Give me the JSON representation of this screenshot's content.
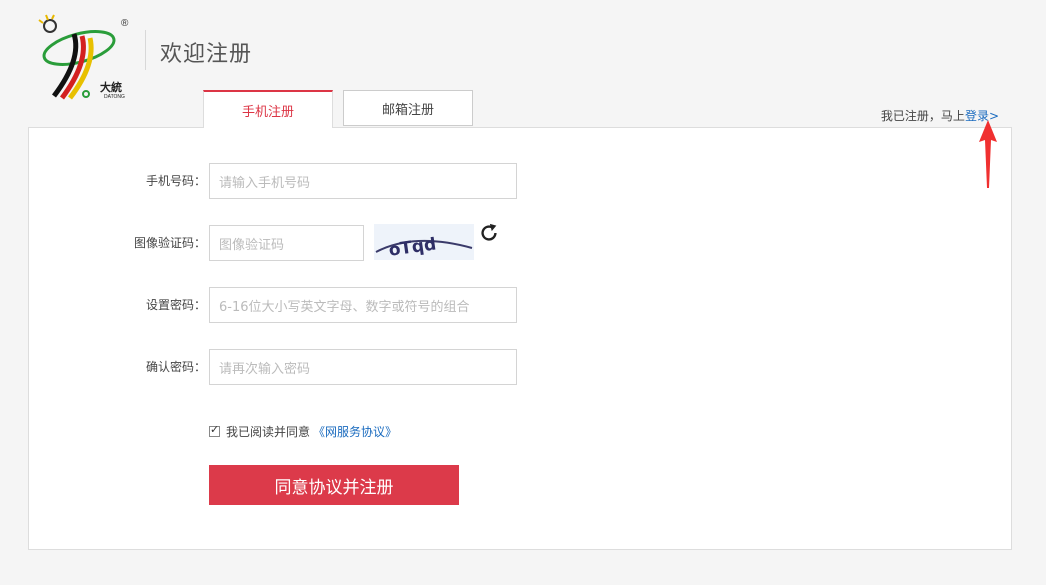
{
  "brand": {
    "name": "大統",
    "name_latin": "DATONG",
    "reg_mark": "®"
  },
  "page_title": "欢迎注册",
  "tabs": [
    {
      "label": "手机注册",
      "active": true
    },
    {
      "label": "邮箱注册",
      "active": false
    }
  ],
  "login_hint": {
    "text": "我已注册，马上",
    "link": "登录>"
  },
  "form": {
    "phone": {
      "label": "手机号码：",
      "placeholder": "请输入手机号码"
    },
    "captcha": {
      "label": "图像验证码：",
      "placeholder": "图像验证码",
      "image_text": "oTqd"
    },
    "password": {
      "label": "设置密码：",
      "placeholder": "6-16位大小写英文字母、数字或符号的组合"
    },
    "confirm": {
      "label": "确认密码：",
      "placeholder": "请再次输入密码"
    },
    "agree": {
      "checked": true,
      "text": "我已阅读并同意",
      "link": "《网服务协议》"
    },
    "submit_label": "同意协议并注册"
  },
  "colors": {
    "accent": "#dc3a4a",
    "link": "#1a6bbf",
    "background": "#f5f5f5"
  },
  "icons": {
    "refresh": "refresh-icon",
    "annotation": "red-arrow-icon"
  }
}
